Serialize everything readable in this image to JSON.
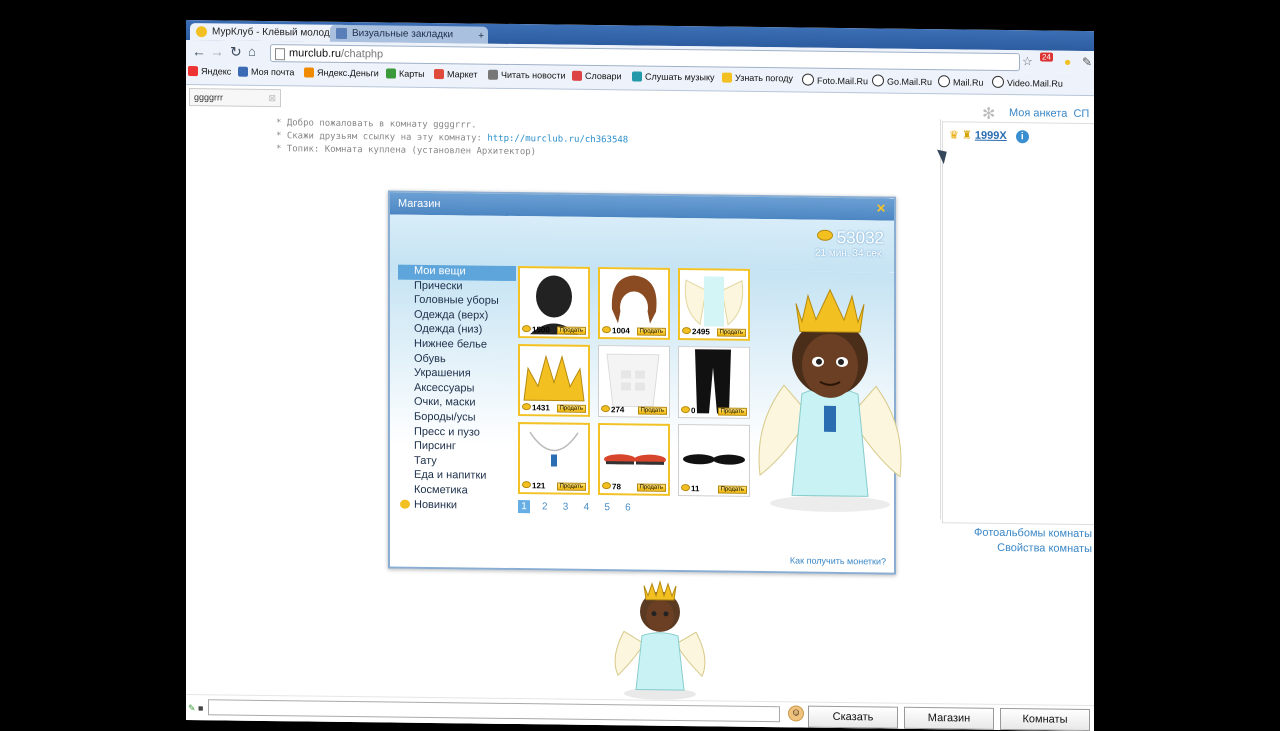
{
  "browser": {
    "tabs": [
      {
        "title": "МурКлуб - Клёвый молод",
        "active": true
      },
      {
        "title": "Визуальные закладки",
        "active": false
      }
    ],
    "address": {
      "host": "murclub.ru",
      "path": "/chatphp"
    },
    "bookmarks": [
      "Яндекс",
      "Моя почта",
      "Яндекс.Деньги",
      "Карты",
      "Маркет",
      "Читать новости",
      "Словари",
      "Слушать музыку",
      "Узнать погоду",
      "Foto.Mail.Ru",
      "Go.Mail.Ru",
      "Mail.Ru",
      "Video.Mail.Ru"
    ],
    "badge": "24"
  },
  "chat": {
    "room_tab": "ggggrrr",
    "my_profile": "Моя анкета",
    "my_profile_tail": "СП",
    "messages": [
      {
        "text": "* Добро пожаловать в комнату ggggrrr."
      },
      {
        "text": "* Скажи друзьям ссылку на эту комнату: ",
        "link": "http://murclub.ru/ch363548"
      },
      {
        "text": "* Топик: Комната куплена (установлен Архитектор)"
      }
    ],
    "user": {
      "name": "1999X"
    },
    "links": [
      "Фотоальбомы комнаты",
      "Свойства комнаты"
    ],
    "buttons": {
      "say": "Сказать",
      "shop": "Магазин",
      "rooms": "Комнаты"
    }
  },
  "shop": {
    "title": "Магазин",
    "coins": "53032",
    "timer": "21 мин. 34 сек.",
    "categories": [
      "Мои вещи",
      "Прически",
      "Головные уборы",
      "Одежда (верх)",
      "Одежда (низ)",
      "Нижнее белье",
      "Обувь",
      "Украшения",
      "Аксессуары",
      "Очки, маски",
      "Бороды/усы",
      "Пресс и пузо",
      "Пирсинг",
      "Тату",
      "Еда и напитки",
      "Косметика",
      "Новинки"
    ],
    "selected_category": "Мои вещи",
    "items": [
      {
        "price": "1500",
        "icon": "head-icon"
      },
      {
        "price": "1004",
        "icon": "hair-icon"
      },
      {
        "price": "2495",
        "icon": "wings-icon"
      },
      {
        "price": "1431",
        "icon": "crown-icon"
      },
      {
        "price": "274",
        "icon": "abs-icon"
      },
      {
        "price": "0",
        "icon": "pants-icon"
      },
      {
        "price": "121",
        "icon": "necklace-icon"
      },
      {
        "price": "78",
        "icon": "red-shoes-icon"
      },
      {
        "price": "11",
        "icon": "black-shoes-icon"
      }
    ],
    "sell_label": "Продать",
    "pages": [
      "1",
      "2",
      "3",
      "4",
      "5",
      "6"
    ],
    "current_page": "1",
    "how_to_get_coins": "Как получить монетки?"
  }
}
